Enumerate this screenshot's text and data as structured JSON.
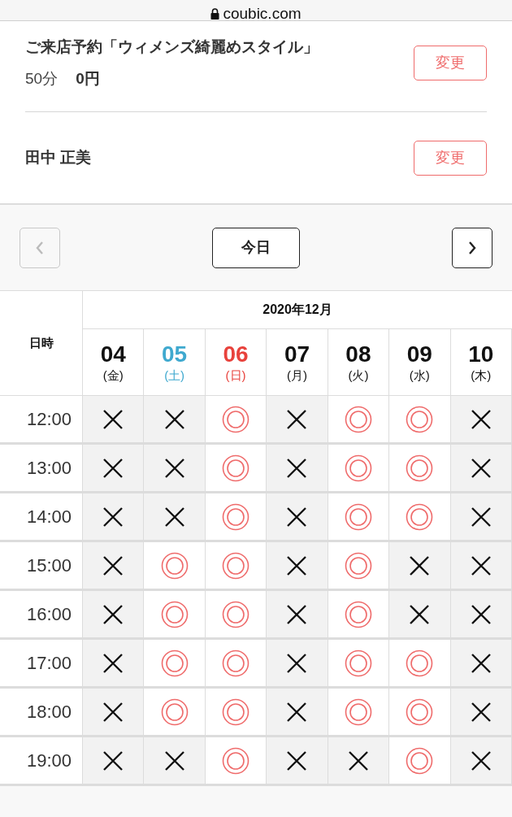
{
  "address_bar": {
    "url": "coubic.com"
  },
  "booking": {
    "title": "ご来店予約「ウィメンズ綺麗めスタイル」",
    "duration": "50分",
    "price": "0円",
    "change_button": "変更"
  },
  "customer": {
    "name": "田中 正美",
    "change_button": "変更"
  },
  "nav": {
    "prev_disabled": true,
    "today_button": "今日",
    "next_disabled": false
  },
  "calendar": {
    "corner_label": "日時",
    "month": "2020年12月",
    "days": [
      {
        "date": "04",
        "weekday": "(金)",
        "kind": "weekday"
      },
      {
        "date": "05",
        "weekday": "(土)",
        "kind": "saturday"
      },
      {
        "date": "06",
        "weekday": "(日)",
        "kind": "sunday"
      },
      {
        "date": "07",
        "weekday": "(月)",
        "kind": "weekday"
      },
      {
        "date": "08",
        "weekday": "(火)",
        "kind": "weekday"
      },
      {
        "date": "09",
        "weekday": "(水)",
        "kind": "weekday"
      },
      {
        "date": "10",
        "weekday": "(木)",
        "kind": "weekday"
      }
    ],
    "rows": [
      {
        "time": "12:00",
        "available": [
          false,
          false,
          true,
          false,
          true,
          true,
          false
        ]
      },
      {
        "time": "13:00",
        "available": [
          false,
          false,
          true,
          false,
          true,
          true,
          false
        ]
      },
      {
        "time": "14:00",
        "available": [
          false,
          false,
          true,
          false,
          true,
          true,
          false
        ]
      },
      {
        "time": "15:00",
        "available": [
          false,
          true,
          true,
          false,
          true,
          false,
          false
        ]
      },
      {
        "time": "16:00",
        "available": [
          false,
          true,
          true,
          false,
          true,
          false,
          false
        ]
      },
      {
        "time": "17:00",
        "available": [
          false,
          true,
          true,
          false,
          true,
          true,
          false
        ]
      },
      {
        "time": "18:00",
        "available": [
          false,
          true,
          true,
          false,
          true,
          true,
          false
        ]
      },
      {
        "time": "19:00",
        "available": [
          false,
          false,
          true,
          false,
          false,
          true,
          false
        ]
      }
    ]
  }
}
